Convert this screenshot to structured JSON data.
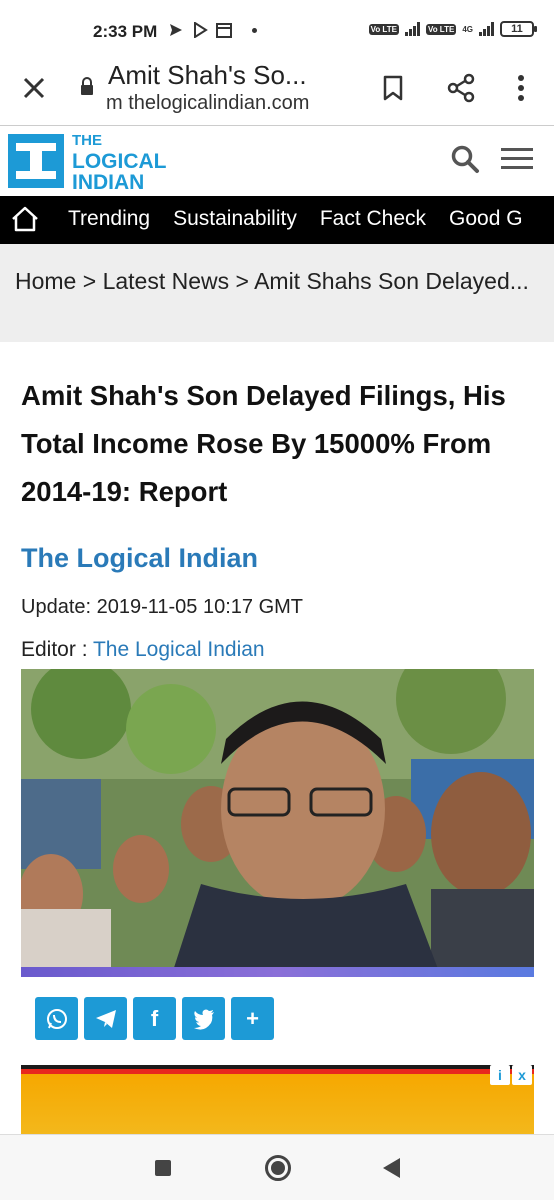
{
  "status_bar": {
    "time": "2:33 PM",
    "volte_label": "Vo LTE",
    "network_4g": "4G",
    "battery": "11"
  },
  "browser": {
    "page_title": "Amit Shah's So...",
    "url": "m thelogicalindian.com"
  },
  "site": {
    "logo_line1": "THE",
    "logo_line2": "LOGICAL",
    "logo_line3": "INDIAN",
    "brand_color": "#1d9ad6"
  },
  "nav": {
    "items": [
      "Trending",
      "Sustainability",
      "Fact Check",
      "Good G"
    ]
  },
  "breadcrumb": {
    "text": "Home > Latest News > Amit Shahs Son Delayed..."
  },
  "article": {
    "headline": "Amit Shah's Son Delayed Filings, His Total Income Rose By 15000% From 2014-19: Report",
    "author": "The Logical Indian",
    "update": "Update: 2019-11-05 10:17 GMT",
    "editor_label": "Editor : ",
    "editor_name": "The Logical Indian",
    "link_color": "#2a7ab8"
  },
  "share": {
    "buttons": [
      "whatsapp-icon",
      "telegram-icon",
      "facebook-icon",
      "twitter-icon",
      "plus-icon"
    ],
    "plus_label": "+",
    "facebook_label": "f"
  },
  "ad": {
    "info_label": "i",
    "close_label": "x"
  }
}
